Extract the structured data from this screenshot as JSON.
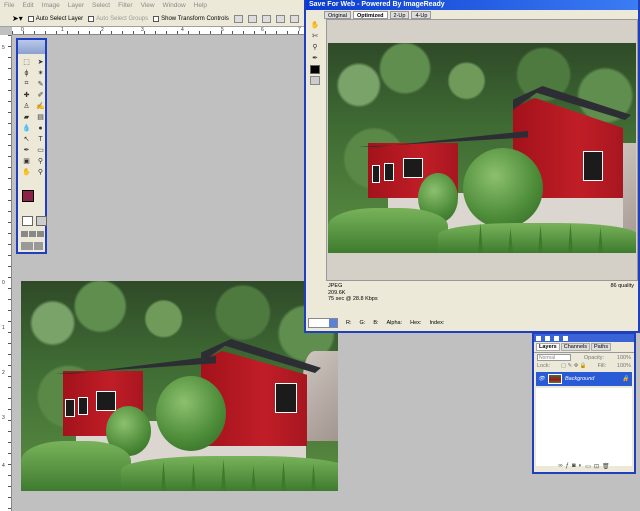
{
  "menu": [
    "File",
    "Edit",
    "Image",
    "Layer",
    "Select",
    "Filter",
    "View",
    "Window",
    "Help"
  ],
  "options": {
    "auto_select_layer": "Auto Select Layer",
    "auto_select_groups": "Auto Select Groups",
    "show_transform_controls": "Show Transform Controls"
  },
  "ruler": {
    "h": [
      "0",
      "1",
      "2",
      "3",
      "4",
      "5",
      "6",
      "7"
    ],
    "v": [
      "5",
      "0",
      "1",
      "2",
      "3",
      "4"
    ]
  },
  "colors": {
    "foreground": "#8c2045",
    "background": "#ffffff",
    "accent": "#1f3fbf"
  },
  "save_for_web": {
    "title": "Save For Web - Powered By ImageReady",
    "tabs": [
      "Original",
      "Optimized",
      "2-Up",
      "4-Up"
    ],
    "active_tab": "Optimized",
    "format": "JPEG",
    "size": "209.6K",
    "time": "75 sec @ 28.8 Kbps",
    "quality": "86 quality",
    "bottom": {
      "r": "R:",
      "g": "G:",
      "b": "B:",
      "alpha": "Alpha:",
      "hex": "Hex:",
      "index": "Index:"
    }
  },
  "layers_panel": {
    "tabs": [
      "Layers",
      "Channels",
      "Paths"
    ],
    "active_tab": "Layers",
    "blend_mode": "Normal",
    "opacity_label": "Opacity:",
    "opacity_value": "100%",
    "lock_label": "Lock:",
    "fill_label": "Fill:",
    "fill_value": "100%",
    "layer_name": "Background"
  }
}
